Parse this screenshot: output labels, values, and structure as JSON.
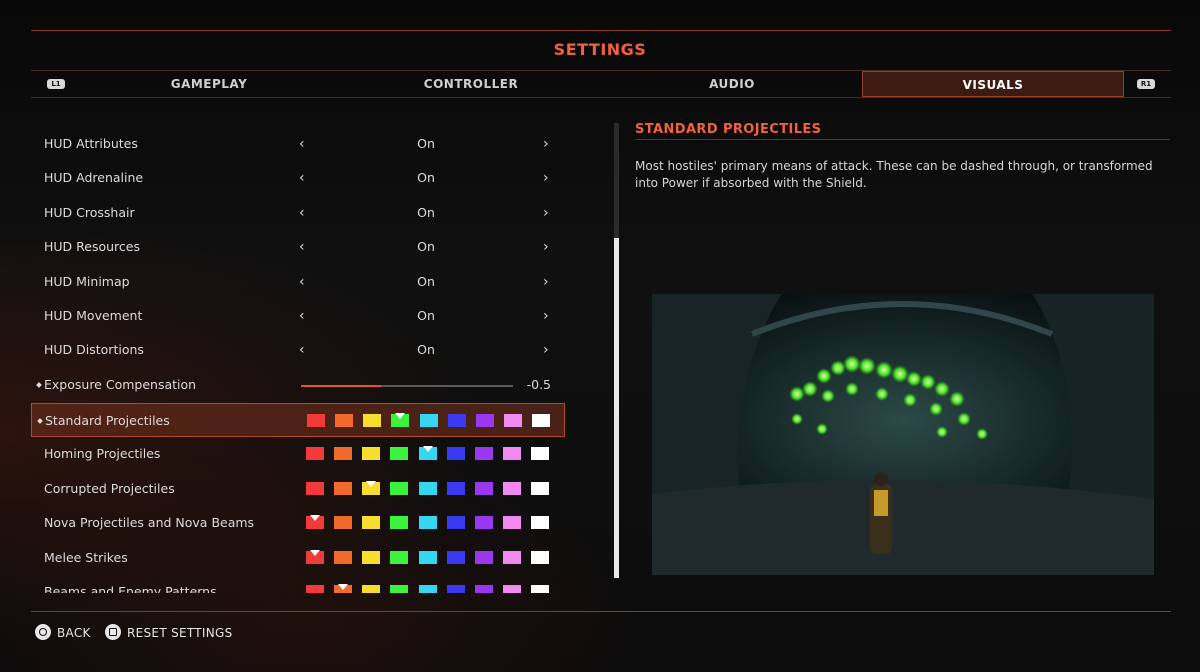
{
  "header": {
    "title": "SETTINGS"
  },
  "tabs": {
    "left_bumper": "L1",
    "right_bumper": "R1",
    "items": [
      {
        "label": "GAMEPLAY",
        "active": false
      },
      {
        "label": "CONTROLLER",
        "active": false
      },
      {
        "label": "AUDIO",
        "active": false
      },
      {
        "label": "VISUALS",
        "active": true
      }
    ]
  },
  "palette": [
    "#f23a3a",
    "#f06a2c",
    "#f7dd2e",
    "#3df23a",
    "#35d6f2",
    "#3a3af0",
    "#9a38f0",
    "#f08af0",
    "#ffffff"
  ],
  "settings": {
    "toggles": [
      {
        "label": "HUD Attributes",
        "value": "On"
      },
      {
        "label": "HUD Adrenaline",
        "value": "On"
      },
      {
        "label": "HUD Crosshair",
        "value": "On"
      },
      {
        "label": "HUD Resources",
        "value": "On"
      },
      {
        "label": "HUD Minimap",
        "value": "On"
      },
      {
        "label": "HUD Movement",
        "value": "On"
      },
      {
        "label": "HUD Distortions",
        "value": "On"
      }
    ],
    "exposure": {
      "label": "Exposure Compensation",
      "value": "-0.5",
      "fill_fraction": 0.375,
      "modified": true
    },
    "colors": [
      {
        "label": "Standard Projectiles",
        "selected_index": 3,
        "modified": true,
        "selected": true
      },
      {
        "label": "Homing Projectiles",
        "selected_index": 4,
        "modified": false,
        "selected": false
      },
      {
        "label": "Corrupted Projectiles",
        "selected_index": 2,
        "modified": false,
        "selected": false
      },
      {
        "label": "Nova Projectiles and Nova Beams",
        "selected_index": 0,
        "modified": false,
        "selected": false
      },
      {
        "label": "Melee Strikes",
        "selected_index": 0,
        "modified": false,
        "selected": false
      },
      {
        "label": "Beams and Enemy Patterns",
        "selected_index": 1,
        "modified": false,
        "selected": false
      }
    ]
  },
  "detail": {
    "title": "STANDARD PROJECTILES",
    "description": "Most hostiles' primary means of attack. These can be dashed through, or transformed into Power if absorbed with the Shield."
  },
  "footer": {
    "back_label": "BACK",
    "reset_label": "RESET SETTINGS"
  }
}
